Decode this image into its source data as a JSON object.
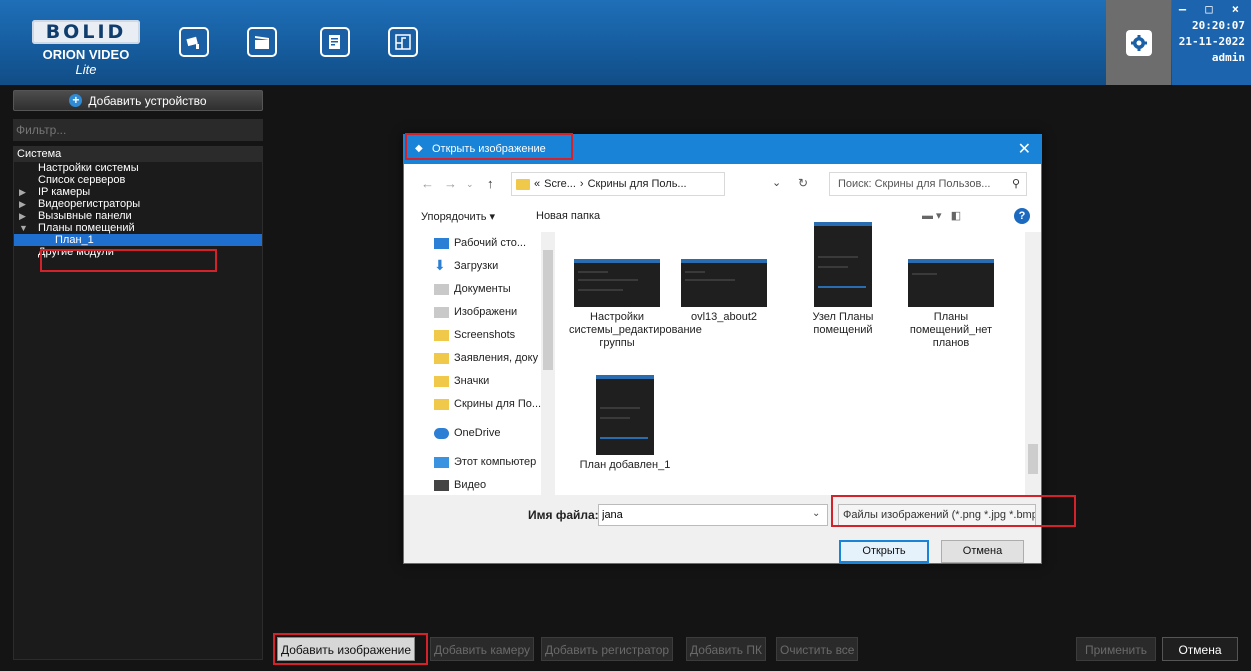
{
  "header": {
    "brand": "BOLID",
    "product": "ORION VIDEO",
    "product_edition": "Lite",
    "icons": [
      "camera-icon",
      "video-clapper-icon",
      "report-icon",
      "plan-icon",
      "settings-icon"
    ],
    "window_controls": "– □ ×",
    "time": "20:20:07",
    "date": "21-11-2022",
    "user": "admin"
  },
  "left_panel": {
    "add_device_label": "Добавить устройство",
    "filter_placeholder": "Фильтр...",
    "tree": {
      "root": "Система",
      "items": [
        {
          "label": "Настройки системы",
          "expandable": false
        },
        {
          "label": "Список серверов",
          "expandable": false
        },
        {
          "label": "IP камеры",
          "expandable": true
        },
        {
          "label": "Видеорегистраторы",
          "expandable": true
        },
        {
          "label": "Вызывные панели",
          "expandable": true
        },
        {
          "label": "Планы помещений",
          "expandable": true,
          "expanded": true
        },
        {
          "label": "План_1",
          "child": true,
          "selected": true
        },
        {
          "label": "Другие модули",
          "expandable": false
        }
      ]
    }
  },
  "dialog": {
    "title": "Открыть изображение",
    "close": "✕",
    "address": {
      "prefix": "«",
      "segment1": "Scre...",
      "sep": "›",
      "segment2": "Скрины для Поль...",
      "dropdown": "⌄"
    },
    "search_placeholder": "Поиск: Скрины для Пользов...",
    "toolbar": {
      "organize": "Упорядочить ▾",
      "new_folder": "Новая папка"
    },
    "nav_items": [
      {
        "label": "Рабочий сто...",
        "icon": "desktop-icon",
        "pinned": true
      },
      {
        "label": "Загрузки",
        "icon": "downloads-icon",
        "pinned": true
      },
      {
        "label": "Документы",
        "icon": "documents-icon",
        "pinned": true
      },
      {
        "label": "Изображени",
        "icon": "pictures-icon",
        "pinned": true
      },
      {
        "label": "Screenshots",
        "icon": "folder-icon",
        "pinned": false
      },
      {
        "label": "Заявления, доку",
        "icon": "folder-icon",
        "pinned": false
      },
      {
        "label": "Значки",
        "icon": "folder-icon",
        "pinned": false
      },
      {
        "label": "Скрины для По...",
        "icon": "folder-icon",
        "pinned": false
      },
      {
        "label": "OneDrive",
        "icon": "onedrive-icon",
        "pinned": false
      },
      {
        "label": "Этот компьютер",
        "icon": "computer-icon",
        "pinned": false
      },
      {
        "label": "Видео",
        "icon": "video-icon",
        "pinned": false
      }
    ],
    "files": [
      {
        "name": "Настройки системы_редактирование группы"
      },
      {
        "name": "ovl13_about2"
      },
      {
        "name": "Узел Планы помещений"
      },
      {
        "name": "Планы помещений_нет планов"
      },
      {
        "name": "План добавлен_1"
      }
    ],
    "filename_label": "Имя файла:",
    "filename_value": "jana",
    "filetype": "Файлы изображений (*.png *.jpg *.bmp)",
    "open_label": "Открыть",
    "cancel_label": "Отмена"
  },
  "bottom_toolbar": {
    "add_image": "Добавить изображение",
    "add_camera": "Добавить камеру",
    "add_recorder": "Добавить регистратор",
    "add_pc": "Добавить ПК",
    "clear_all": "Очистить все",
    "apply": "Применить",
    "cancel": "Отмена"
  },
  "colors": {
    "header_blue": "#1a66ad",
    "dialog_accent": "#1883d7",
    "highlight_red": "#d4222b",
    "selection_blue": "#1f6fcf"
  }
}
